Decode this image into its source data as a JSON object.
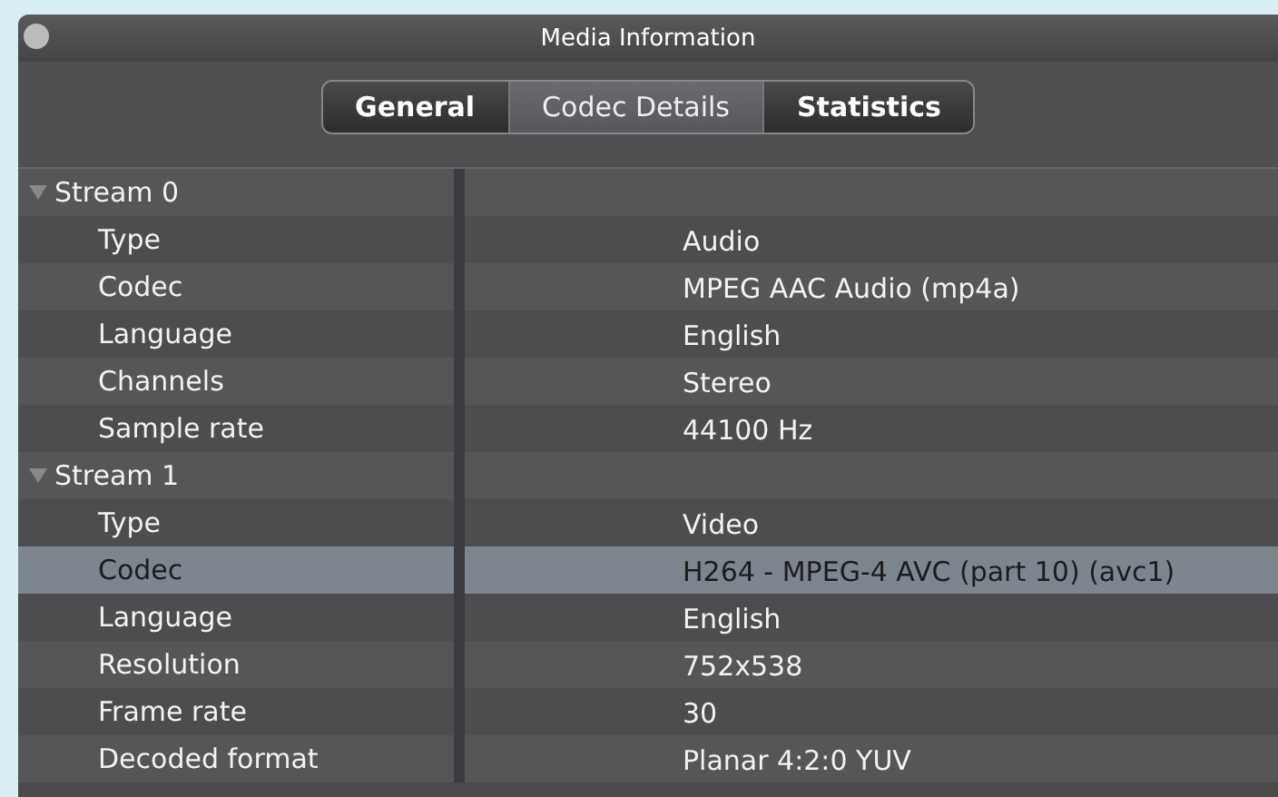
{
  "window": {
    "title": "Media Information"
  },
  "tabs": [
    {
      "label": "General",
      "selected": false
    },
    {
      "label": "Codec Details",
      "selected": true
    },
    {
      "label": "Statistics",
      "selected": false
    }
  ],
  "streams": [
    {
      "label": "Stream 0",
      "expanded": true,
      "properties": [
        {
          "name": "Type",
          "value": "Audio",
          "selected": false
        },
        {
          "name": "Codec",
          "value": "MPEG AAC Audio (mp4a)",
          "selected": false
        },
        {
          "name": "Language",
          "value": "English",
          "selected": false
        },
        {
          "name": "Channels",
          "value": "Stereo",
          "selected": false
        },
        {
          "name": "Sample rate",
          "value": "44100 Hz",
          "selected": false
        }
      ]
    },
    {
      "label": "Stream 1",
      "expanded": true,
      "properties": [
        {
          "name": "Type",
          "value": "Video",
          "selected": false
        },
        {
          "name": "Codec",
          "value": "H264 - MPEG-4 AVC (part 10) (avc1)",
          "selected": true
        },
        {
          "name": "Language",
          "value": "English",
          "selected": false
        },
        {
          "name": "Resolution",
          "value": "752x538",
          "selected": false
        },
        {
          "name": "Frame rate",
          "value": "30",
          "selected": false
        },
        {
          "name": "Decoded format",
          "value": "Planar 4:2:0 YUV",
          "selected": false
        }
      ]
    }
  ]
}
